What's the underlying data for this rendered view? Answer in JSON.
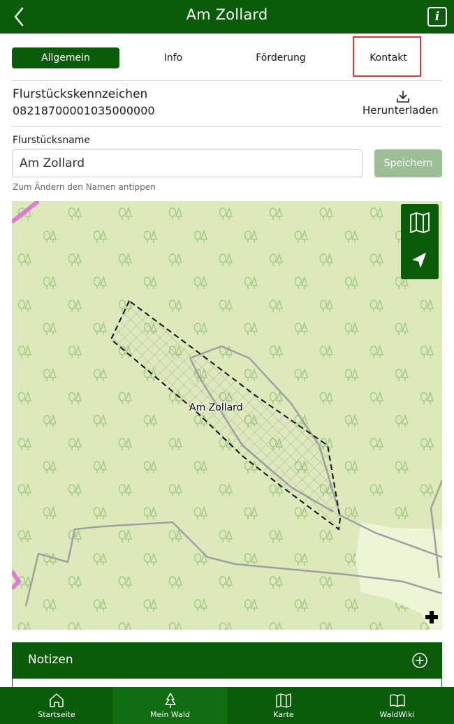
{
  "header": {
    "title": "Am Zollard",
    "back_icon": "chevron-left-icon",
    "info_icon": "info-icon",
    "info_glyph": "i"
  },
  "tabs": [
    {
      "label": "Allgemein",
      "active": true
    },
    {
      "label": "Info",
      "active": false
    },
    {
      "label": "Förderung",
      "active": false
    },
    {
      "label": "Kontakt",
      "active": false
    }
  ],
  "parcel": {
    "id_label": "Flurstückskennzeichen",
    "id_value": "08218700001035000000",
    "download_label": "Herunterladen",
    "download_icon": "download-icon"
  },
  "name": {
    "label": "Flurstücksname",
    "value": "Am Zollard",
    "save_label": "Speichern",
    "hint": "Zum Ändern den Namen antippen"
  },
  "map": {
    "parcel_label": "Am Zollard",
    "controls": [
      "map-layers-icon",
      "locate-icon"
    ]
  },
  "notes": {
    "title": "Notizen",
    "add_icon": "plus-circle-icon"
  },
  "bottom_nav": [
    {
      "label": "Startseite",
      "icon": "home-icon",
      "active": false
    },
    {
      "label": "Mein Wald",
      "icon": "tree-icon",
      "active": true
    },
    {
      "label": "Karte",
      "icon": "map-icon",
      "active": false
    },
    {
      "label": "WaldWiki",
      "icon": "book-icon",
      "active": false
    }
  ],
  "colors": {
    "primary": "#0a5c0a",
    "save_disabled": "#9cbf96",
    "map_forest": "#dde9bb",
    "highlight_red": "#e53935"
  }
}
